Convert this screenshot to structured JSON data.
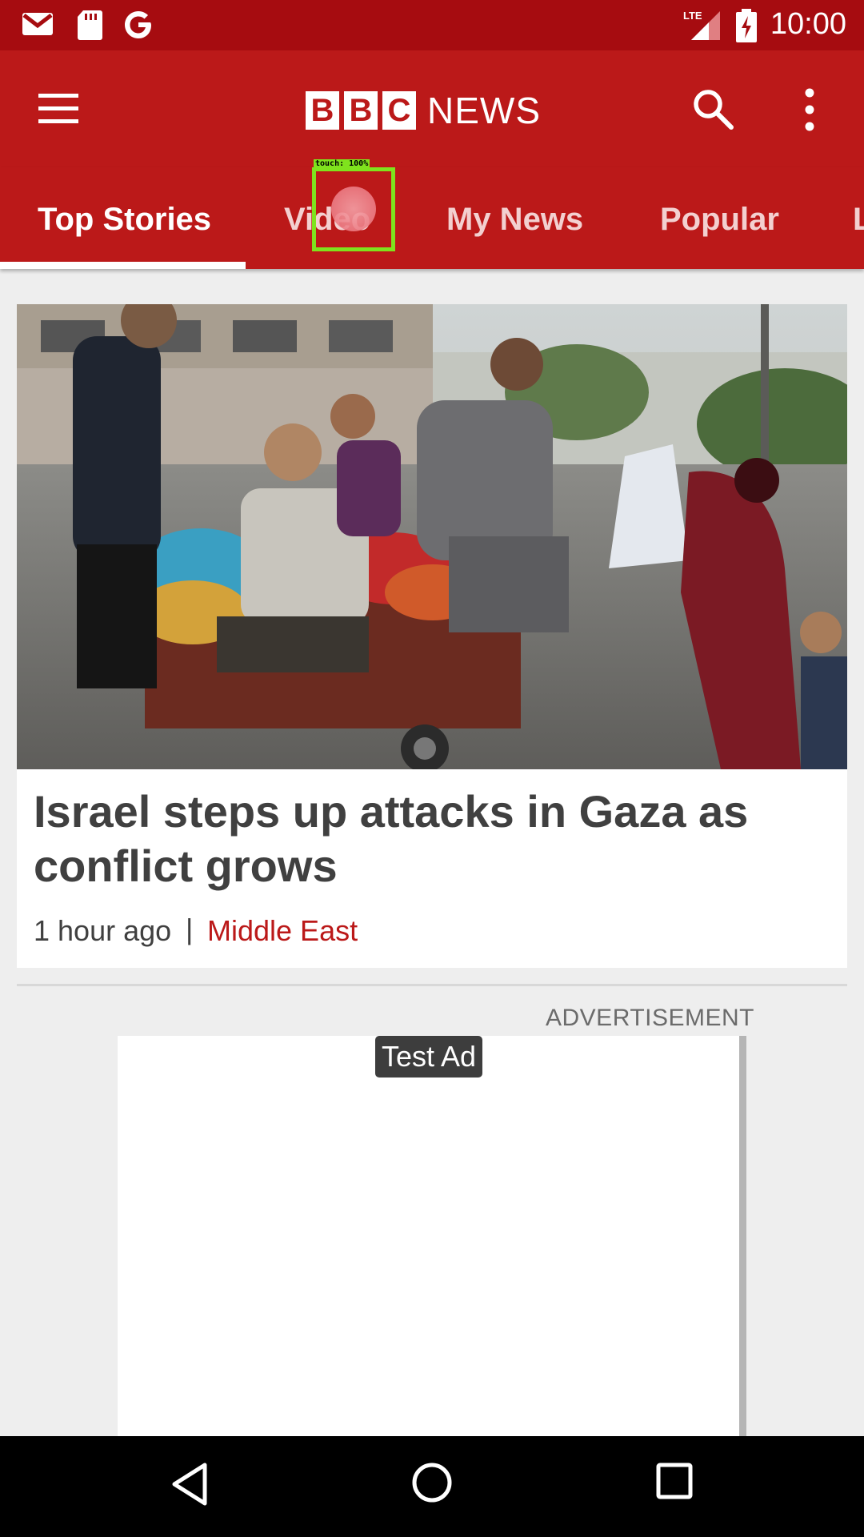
{
  "status_bar": {
    "time": "10:00",
    "left_icons": [
      "gmail-icon",
      "sd-card-icon",
      "google-icon"
    ],
    "right_icons": [
      "lte-signal-icon",
      "battery-charging-icon"
    ]
  },
  "app_bar": {
    "logo_letters": [
      "B",
      "B",
      "C"
    ],
    "logo_text": "NEWS",
    "icons": [
      "menu-icon",
      "search-icon",
      "more-vert-icon"
    ]
  },
  "tabs": [
    {
      "label": "Top Stories",
      "active": true
    },
    {
      "label": "Video",
      "active": false
    },
    {
      "label": "My News",
      "active": false
    },
    {
      "label": "Popular",
      "active": false
    },
    {
      "label": "L",
      "active": false
    }
  ],
  "touch_overlay": {
    "label": "touch: 100%"
  },
  "article": {
    "headline": "Israel steps up attacks in Gaza as conflict grows",
    "time": "1 hour ago",
    "separator": "|",
    "section": "Middle East"
  },
  "ad": {
    "label": "ADVERTISEMENT",
    "tag": "Test Ad"
  },
  "nav_bar": {
    "icons": [
      "back-icon",
      "home-icon",
      "recents-icon"
    ]
  },
  "colors": {
    "brand_red": "#bb1919",
    "status_red": "#a60c10",
    "section_red": "#bb1919",
    "touch_green": "#7fe31d"
  }
}
